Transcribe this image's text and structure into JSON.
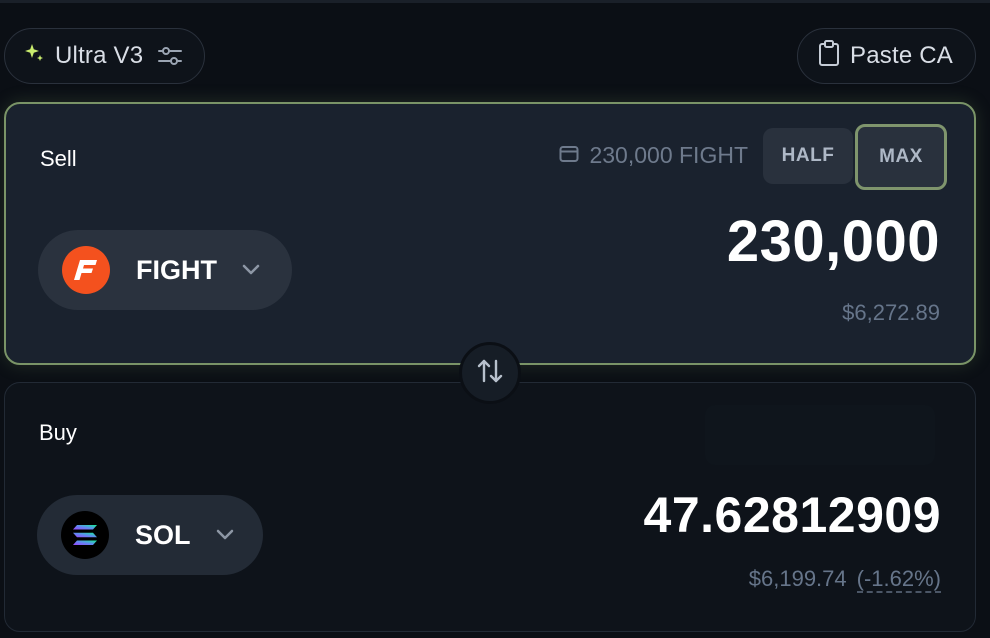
{
  "toolbar": {
    "ultra_label": "Ultra V3",
    "paste_label": "Paste CA"
  },
  "sell": {
    "title": "Sell",
    "balance": "230,000 FIGHT",
    "half_label": "HALF",
    "max_label": "MAX",
    "token": "FIGHT",
    "amount": "230,000",
    "usd": "$6,272.89"
  },
  "buy": {
    "title": "Buy",
    "token": "SOL",
    "amount": "47.62812909",
    "usd": "$6,199.74",
    "pct": "(-1.62%)"
  },
  "colors": {
    "accent_border": "#7a9467",
    "fight_logo": "#f4511e",
    "sparkle": "#c9ec6e"
  },
  "icons": {
    "ultra": "sparkle-icon",
    "settings": "sliders-icon",
    "paste": "clipboard-icon",
    "wallet": "wallet-icon",
    "swap": "swap-arrows-icon"
  }
}
